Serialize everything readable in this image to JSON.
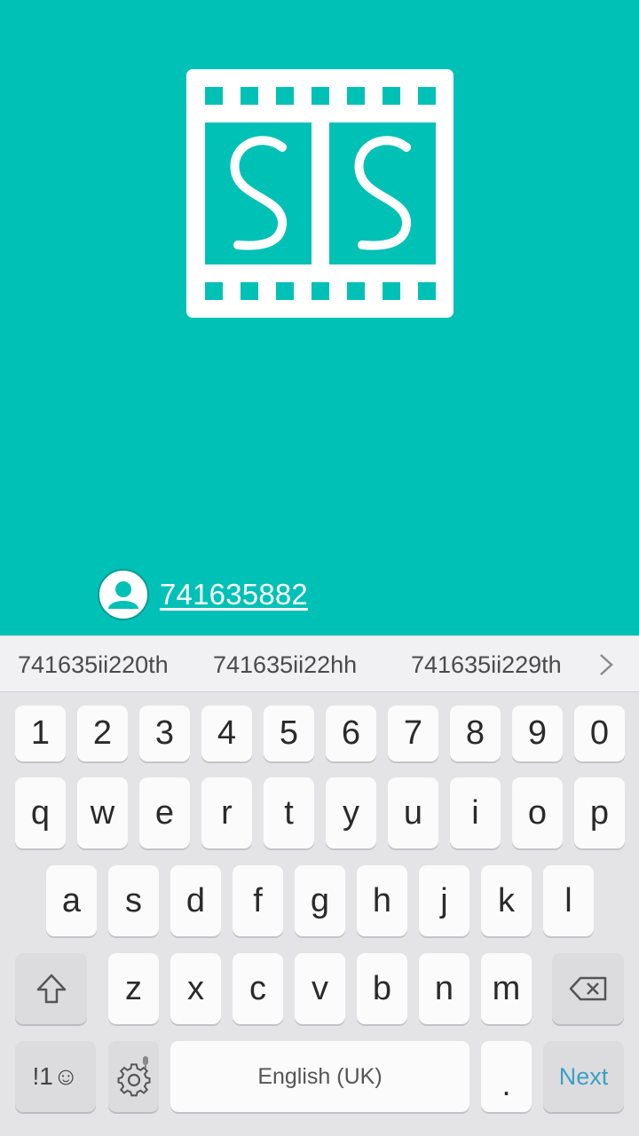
{
  "app": {
    "logo_icon": "film-strip-ss-logo",
    "user_icon": "user-icon",
    "username_value": "741635882",
    "colors": {
      "background": "#00c1b6",
      "foreground": "#ffffff"
    }
  },
  "keyboard": {
    "suggestions": [
      "741635ii220th",
      "741635ii22hh",
      "741635ii229th"
    ],
    "row_numbers": [
      "1",
      "2",
      "3",
      "4",
      "5",
      "6",
      "7",
      "8",
      "9",
      "0"
    ],
    "row_1": [
      "q",
      "w",
      "e",
      "r",
      "t",
      "y",
      "u",
      "i",
      "o",
      "p"
    ],
    "row_2": [
      "a",
      "s",
      "d",
      "f",
      "g",
      "h",
      "j",
      "k",
      "l"
    ],
    "row_3": [
      "z",
      "x",
      "c",
      "v",
      "b",
      "n",
      "m"
    ],
    "symbols_label": "!1☺",
    "space_label": "English (UK)",
    "period_label": ".",
    "action_label": "Next",
    "accent_color": "#3ba0c4"
  }
}
